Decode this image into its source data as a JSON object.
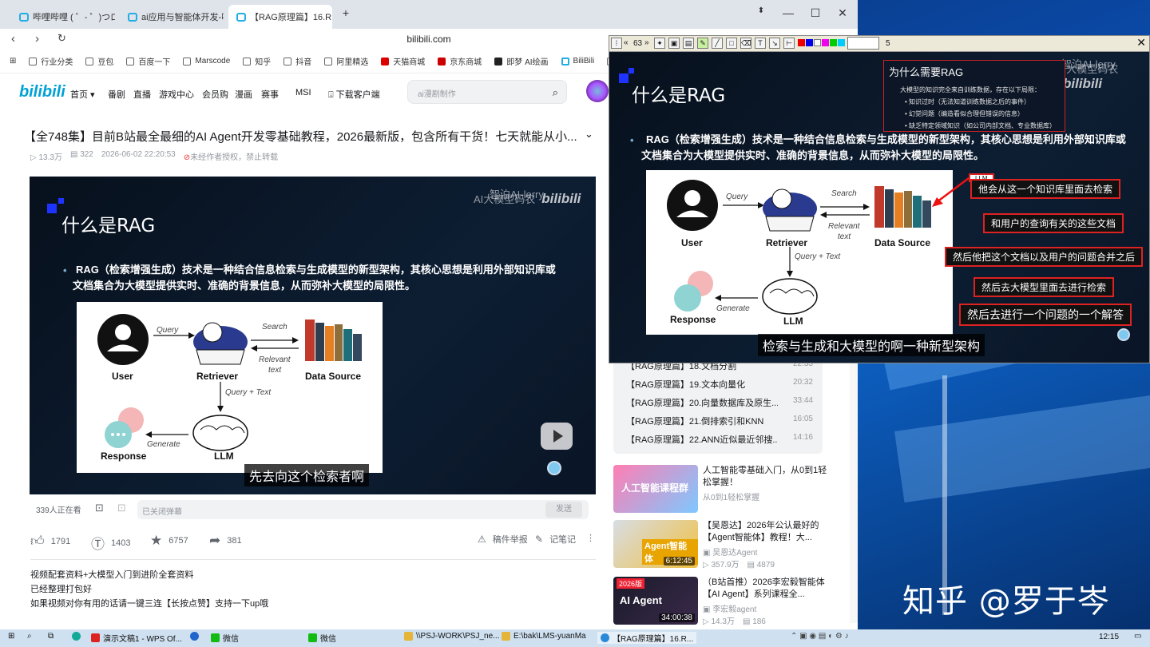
{
  "browser": {
    "tabs": [
      {
        "label": "哔哩哔哩 ( ゜- ゜)つロ 干",
        "active": false
      },
      {
        "label": "ai应用与智能体开发-哔哩",
        "active": false
      },
      {
        "label": "【RAG原理篇】16.R",
        "active": true
      }
    ],
    "url": "bilibili.com",
    "bookmarks": [
      "行业分类",
      "豆包",
      "百度一下",
      "Marscode",
      "知乎",
      "抖音",
      "阿里精选",
      "天猫商城",
      "京东商城",
      "即梦 AI绘画",
      "BiliBili",
      "今日"
    ]
  },
  "bili_nav": {
    "logo": "bilibili",
    "items": [
      "首页",
      "番剧",
      "直播",
      "游戏中心",
      "会员购",
      "漫画",
      "赛事",
      "MSI"
    ],
    "download": "下载客户端",
    "search_placeholder": "ai漫剧制作"
  },
  "video": {
    "title": "【全748集】目前B站最全最细的AI Agent开发零基础教程，2026最新版，包含所有干货！七天就能从小...",
    "views": "13.3万",
    "danmaku_count": "322",
    "date": "2026-06-02 22:20:53",
    "copyright": "未经作者授权，禁止转载",
    "watching": "339人正在看",
    "danmaku_placeholder": "已关闭弹幕",
    "send": "发送",
    "likes": "1791",
    "coins": "1403",
    "favorites": "6757",
    "shares": "381",
    "report": "稿件举报",
    "notes": "记笔记",
    "description": [
      "视频配套资料+大模型入门到进阶全套资料",
      "已经整理打包好",
      "如果视频对你有用的话请一键三连【长按点赞】支持一下up哦"
    ]
  },
  "slide": {
    "watermark_line1": "智泊AI-lerry",
    "watermark_line2": "AI大模型码农",
    "watermark_brand": "bilibili",
    "heading": "什么是RAG",
    "bullet_line1": "RAG（检索增强生成）技术是一种结合信息检索与生成模型的新型架构，其核心思想是利用外部知识库或",
    "bullet_line2": "文档集合为大模型提供实时、准确的背景信息，从而弥补大模型的局限性。",
    "diagram": {
      "user": "User",
      "retriever": "Retriever",
      "data_source": "Data Source",
      "response": "Response",
      "llm": "LLM",
      "query": "Query",
      "search": "Search",
      "relevant_text_1": "Relevant",
      "relevant_text_2": "text",
      "query_text": "Query + Text",
      "generate": "Generate"
    },
    "subtitle": "先去向这个检索者啊"
  },
  "overlay": {
    "toolbar_num": "63",
    "toolbar_num2": "5",
    "box_title": "为什么需要RAG",
    "box_lines": [
      "大模型的知识完全来自训练数据，存在以下局限：",
      "• 知识过时（无法知道训练数据之后的事件）",
      "• 幻觉问题（编造看似合理但错误的信息）",
      "• 缺乏特定领域知识（如公司内部文档、专业数据库）"
    ],
    "annotation_llm": "LLM",
    "annotations": [
      "他会从这一个知识库里面去检索",
      "和用户的查询有关的这些文档",
      "然后他把这个文档以及用户的问题合并之后",
      "然后去大模型里面去进行检索",
      "然后去进行一个问题的一个解答"
    ],
    "subtitle": "检索与生成和大模型的啊一种新型架构"
  },
  "playlist": [
    {
      "title": "【RAG原理篇】18.文档分割",
      "duration": "22:33"
    },
    {
      "title": "【RAG原理篇】19.文本向量化",
      "duration": "20:32"
    },
    {
      "title": "【RAG原理篇】20.向量数据库及原生...",
      "duration": "33:44"
    },
    {
      "title": "【RAG原理篇】21.倒排索引和KNN",
      "duration": "16:05"
    },
    {
      "title": "【RAG原理篇】22.ANN近似最近邻搜...",
      "duration": "14:16"
    }
  ],
  "recommendations": [
    {
      "title": "人工智能零基础入门，从0到1轻松掌握！",
      "sub": "从0到1轻松掌握",
      "duration": "",
      "thumb_text": "人工智能课程群",
      "stats": ""
    },
    {
      "title": "【吴恩达】2026年公认最好的【Agent智能体】教程！大...",
      "sub": "吴恩达Agent",
      "duration": "6:12:45",
      "thumb_text": "Agent智能体",
      "stats": "357.9万 · 4879"
    },
    {
      "title": "（B站首推）2026李宏毅智能体【AI Agent】系列课程全...",
      "sub": "李宏毅agent",
      "duration": "34:00:38",
      "thumb_text": "AI Agent",
      "stats": "14.3万 · 186"
    }
  ],
  "rec_stats": {
    "r2_views": "357.9万",
    "r2_danmaku": "4879",
    "r3_views": "14.3万",
    "r3_danmaku": "186"
  },
  "desktop": {
    "zhihu_watermark": "知乎 @罗于岑"
  },
  "taskbar": {
    "items": [
      "演示文稿1 - WPS Of...",
      "微信",
      "微信",
      "\\\\PSJ-WORK\\PSJ_ne...",
      "E:\\bak\\LMS-yuanMa",
      "【RAG原理篇】16.R..."
    ],
    "clock": "12:15"
  }
}
